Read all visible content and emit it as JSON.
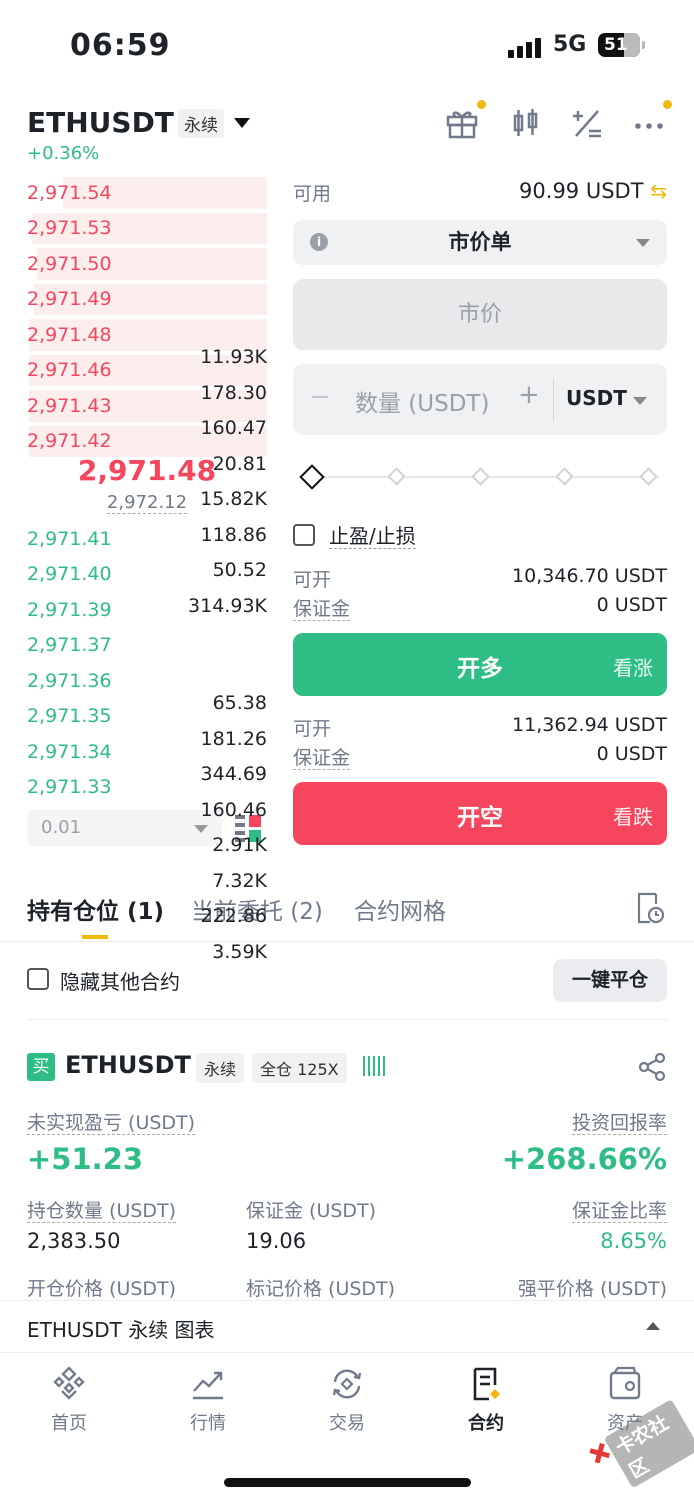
{
  "status": {
    "time": "06:59",
    "network": "5G",
    "battery": "51"
  },
  "header": {
    "pair": "ETHUSDT",
    "contract_type": "永续",
    "change": "+0.36%"
  },
  "orderbook": {
    "asks": [
      {
        "price": "2,971.54",
        "qty": "11.93K",
        "depth": 0.85
      },
      {
        "price": "2,971.53",
        "qty": "178.30",
        "depth": 0.98
      },
      {
        "price": "2,971.50",
        "qty": "160.47",
        "depth": 0.96
      },
      {
        "price": "2,971.49",
        "qty": "20.81",
        "depth": 0.97
      },
      {
        "price": "2,971.48",
        "qty": "15.82K",
        "depth": 0.99
      },
      {
        "price": "2,971.46",
        "qty": "118.86",
        "depth": 0.99
      },
      {
        "price": "2,971.43",
        "qty": "50.52",
        "depth": 0.99
      },
      {
        "price": "2,971.42",
        "qty": "314.93K",
        "depth": 0.99
      }
    ],
    "last_price": "2,971.48",
    "mark_price": "2,972.12",
    "bids": [
      {
        "price": "2,971.41",
        "qty": "65.38"
      },
      {
        "price": "2,971.40",
        "qty": "181.26"
      },
      {
        "price": "2,971.39",
        "qty": "344.69"
      },
      {
        "price": "2,971.37",
        "qty": "160.46"
      },
      {
        "price": "2,971.36",
        "qty": "2.91K"
      },
      {
        "price": "2,971.35",
        "qty": "7.32K"
      },
      {
        "price": "2,971.34",
        "qty": "222.86"
      },
      {
        "price": "2,971.33",
        "qty": "3.59K"
      }
    ],
    "precision": "0.01"
  },
  "panel": {
    "available_label": "可用",
    "available_value": "90.99 USDT",
    "order_type": "市价单",
    "price_placeholder": "市价",
    "qty_placeholder": "数量 (USDT)",
    "qty_unit": "USDT",
    "tpsl_label": "止盈/止损",
    "long_open_label": "可开",
    "long_open_value": "10,346.70 USDT",
    "long_margin_label": "保证金",
    "long_margin_value": "0 USDT",
    "long_button": "开多",
    "long_sub": "看涨",
    "short_open_label": "可开",
    "short_open_value": "11,362.94 USDT",
    "short_margin_label": "保证金",
    "short_margin_value": "0 USDT",
    "short_button": "开空",
    "short_sub": "看跌"
  },
  "tabs": {
    "positions": "持有仓位 (1)",
    "open_orders": "当前委托 (2)",
    "grid": "合约网格"
  },
  "filters": {
    "hide_other": "隐藏其他合约",
    "close_all": "一键平仓"
  },
  "position": {
    "side_badge": "买",
    "pair": "ETHUSDT",
    "type_tag": "永续",
    "margin_tag": "全仓 125X",
    "unrealized_pnl_label": "未实现盈亏 (USDT)",
    "unrealized_pnl": "+51.23",
    "roe_label": "投资回报率",
    "roe": "+268.66%",
    "size_label": "持仓数量 (USDT)",
    "size": "2,383.50",
    "margin_label": "保证金 (USDT)",
    "margin": "19.06",
    "margin_ratio_label": "保证金比率",
    "margin_ratio": "8.65%",
    "entry_label": "开仓价格 (USDT)",
    "mark_label": "标记价格 (USDT)",
    "liq_label": "强平价格 (USDT)"
  },
  "chart_bar": {
    "label": "ETHUSDT 永续  图表"
  },
  "nav": {
    "home": "首页",
    "markets": "行情",
    "trade": "交易",
    "futures": "合约",
    "assets": "资产"
  },
  "watermark": "卡农社区",
  "colors": {
    "green": "#2ebd85",
    "red": "#f6465d",
    "accent": "#f0b90b"
  }
}
